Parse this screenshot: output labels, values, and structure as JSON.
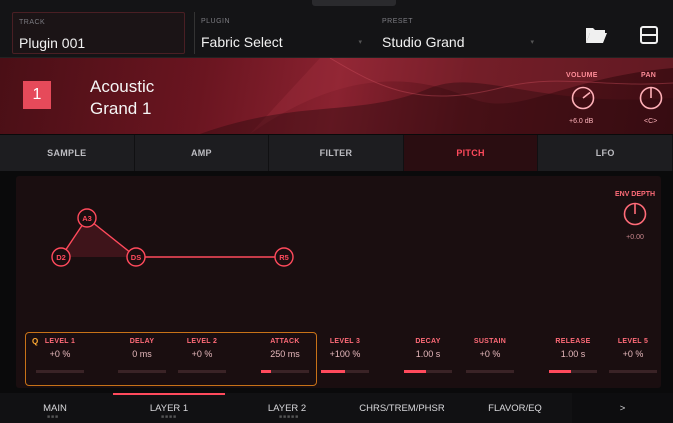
{
  "topbar": {
    "track_label": "TRACK",
    "track_value": "Plugin 001",
    "plugin_label": "PLUGIN",
    "plugin_value": "Fabric Select",
    "preset_label": "PRESET",
    "preset_value": "Studio Grand"
  },
  "header": {
    "layer_number": "1",
    "instrument_line1": "Acoustic",
    "instrument_line2": "Grand 1",
    "volume_label": "VOLUME",
    "volume_value": "+6.0 dB",
    "pan_label": "PAN",
    "pan_value": "<C>"
  },
  "tabs": [
    {
      "label": "SAMPLE"
    },
    {
      "label": "AMP"
    },
    {
      "label": "FILTER"
    },
    {
      "label": "PITCH",
      "active": true
    },
    {
      "label": "LFO"
    }
  ],
  "envelope": {
    "env_depth_label": "ENV DEPTH",
    "env_depth_value": "+0.00",
    "nodes": [
      "D2",
      "A3",
      "DS",
      "R5"
    ]
  },
  "q_label": "Q",
  "params": [
    {
      "label": "LEVEL 1",
      "value": "+0 %",
      "fill": 0.0
    },
    {
      "label": "DELAY",
      "value": "0 ms",
      "fill": 0.0
    },
    {
      "label": "LEVEL 2",
      "value": "+0 %",
      "fill": 0.0
    },
    {
      "label": "ATTACK",
      "value": "250 ms",
      "fill": 0.2
    },
    {
      "label": "LEVEL 3",
      "value": "+100 %",
      "fill": 0.5
    },
    {
      "label": "DECAY",
      "value": "1.00 s",
      "fill": 0.45
    },
    {
      "label": "SUSTAIN",
      "value": "+0 %",
      "fill": 0.0
    },
    {
      "label": "RELEASE",
      "value": "1.00 s",
      "fill": 0.45
    },
    {
      "label": "LEVEL 5",
      "value": "+0 %",
      "fill": 0.0
    }
  ],
  "bottom_tabs": [
    {
      "label": "MAIN"
    },
    {
      "label": "LAYER 1",
      "selected": true
    },
    {
      "label": "LAYER 2"
    },
    {
      "label": "CHRS/TREM/PHSR"
    },
    {
      "label": "FLAVOR/EQ"
    }
  ],
  "more_label": ">",
  "colors": {
    "accent": "#ff4a5c",
    "quick_edit": "#c87218",
    "background": "#0a0a0b"
  }
}
